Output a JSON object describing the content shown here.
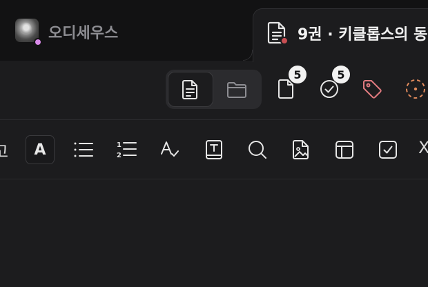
{
  "tabs": [
    {
      "title": "오디세우스",
      "active": false,
      "icon": "avatar",
      "status_color": "#d98ae9"
    },
    {
      "title": "9권 · 키클롭스의 동",
      "active": true,
      "icon": "document-icon",
      "status_color": "#c94f53"
    }
  ],
  "toolbar": {
    "view_toggle": {
      "options": [
        "document-icon",
        "folder-icon"
      ],
      "selected": "document-icon"
    },
    "pages_count": "5",
    "tasks_count": "5",
    "tag_color": "#e07a7f",
    "status_color": "#e08a5c"
  },
  "format_toolbar": {
    "partial_left_char": "고",
    "text_style_letter": "A",
    "partial_right_char": "X",
    "items": [
      "text-style",
      "bullet-list",
      "numbered-list",
      "spell-check",
      "text-box",
      "search",
      "image",
      "table",
      "checkbox"
    ]
  }
}
